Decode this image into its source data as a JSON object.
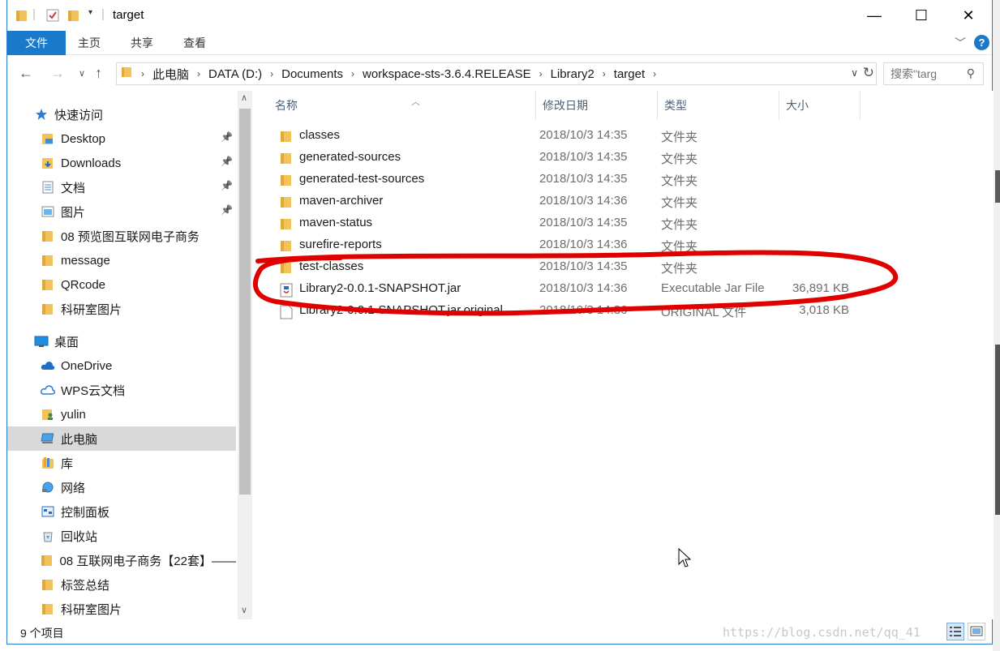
{
  "window": {
    "title": "target",
    "minimize": "—",
    "maximize": "☐",
    "close": "✕"
  },
  "ribbon": {
    "tabs": [
      "文件",
      "主页",
      "共享",
      "查看"
    ],
    "help": "?"
  },
  "address": {
    "segments": [
      "此电脑",
      "DATA (D:)",
      "Documents",
      "workspace-sts-3.6.4.RELEASE",
      "Library2",
      "target"
    ],
    "search_placeholder": "搜索\"targ"
  },
  "sidebar": {
    "items": [
      {
        "label": "快速访问",
        "icon": "star-icon",
        "indent": 0
      },
      {
        "label": "Desktop",
        "icon": "desktop-folder-icon",
        "indent": 1,
        "pinned": true
      },
      {
        "label": "Downloads",
        "icon": "downloads-folder-icon",
        "indent": 1,
        "pinned": true
      },
      {
        "label": "文档",
        "icon": "documents-icon",
        "indent": 1,
        "pinned": true
      },
      {
        "label": "图片",
        "icon": "pictures-icon",
        "indent": 1,
        "pinned": true
      },
      {
        "label": "08 预览图互联网电子商务",
        "icon": "folder-icon",
        "indent": 1
      },
      {
        "label": "message",
        "icon": "folder-icon",
        "indent": 1
      },
      {
        "label": "QRcode",
        "icon": "folder-icon",
        "indent": 1
      },
      {
        "label": "科研室图片",
        "icon": "folder-icon",
        "indent": 1
      },
      {
        "label": "桌面",
        "icon": "desktop-icon",
        "indent": 0
      },
      {
        "label": "OneDrive",
        "icon": "cloud-icon",
        "indent": 1
      },
      {
        "label": "WPS云文档",
        "icon": "wps-cloud-icon",
        "indent": 1
      },
      {
        "label": "yulin",
        "icon": "user-folder-icon",
        "indent": 1
      },
      {
        "label": "此电脑",
        "icon": "computer-icon",
        "indent": 1,
        "selected": true
      },
      {
        "label": "库",
        "icon": "library-icon",
        "indent": 1
      },
      {
        "label": "网络",
        "icon": "network-icon",
        "indent": 1
      },
      {
        "label": "控制面板",
        "icon": "control-panel-icon",
        "indent": 1
      },
      {
        "label": "回收站",
        "icon": "recycle-bin-icon",
        "indent": 1
      },
      {
        "label": "08 互联网电子商务【22套】——",
        "icon": "folder-icon",
        "indent": 1
      },
      {
        "label": "标签总结",
        "icon": "folder-icon",
        "indent": 1
      },
      {
        "label": "科研室图片",
        "icon": "folder-icon",
        "indent": 1
      }
    ]
  },
  "filelist": {
    "columns": [
      "名称",
      "修改日期",
      "类型",
      "大小"
    ],
    "rows": [
      {
        "name": "classes",
        "date": "2018/10/3 14:35",
        "type": "文件夹",
        "size": "",
        "icon": "folder-icon"
      },
      {
        "name": "generated-sources",
        "date": "2018/10/3 14:35",
        "type": "文件夹",
        "size": "",
        "icon": "folder-icon"
      },
      {
        "name": "generated-test-sources",
        "date": "2018/10/3 14:35",
        "type": "文件夹",
        "size": "",
        "icon": "folder-icon"
      },
      {
        "name": "maven-archiver",
        "date": "2018/10/3 14:36",
        "type": "文件夹",
        "size": "",
        "icon": "folder-icon"
      },
      {
        "name": "maven-status",
        "date": "2018/10/3 14:35",
        "type": "文件夹",
        "size": "",
        "icon": "folder-icon"
      },
      {
        "name": "surefire-reports",
        "date": "2018/10/3 14:36",
        "type": "文件夹",
        "size": "",
        "icon": "folder-icon"
      },
      {
        "name": "test-classes",
        "date": "2018/10/3 14:35",
        "type": "文件夹",
        "size": "",
        "icon": "folder-icon"
      },
      {
        "name": "Library2-0.0.1-SNAPSHOT.jar",
        "date": "2018/10/3 14:36",
        "type": "Executable Jar File",
        "size": "36,891 KB",
        "icon": "jar-file-icon"
      },
      {
        "name": "Library2-0.0.1-SNAPSHOT.jar.original",
        "date": "2018/10/3 14:36",
        "type": "ORIGINAL 文件",
        "size": "3,018 KB",
        "icon": "file-icon"
      }
    ]
  },
  "status": {
    "item_count": "9 个项目",
    "watermark": "https://blog.csdn.net/qq_41"
  },
  "colors": {
    "accent": "#1979ca",
    "annotation": "#e00000",
    "folder": "#f2c35a"
  }
}
